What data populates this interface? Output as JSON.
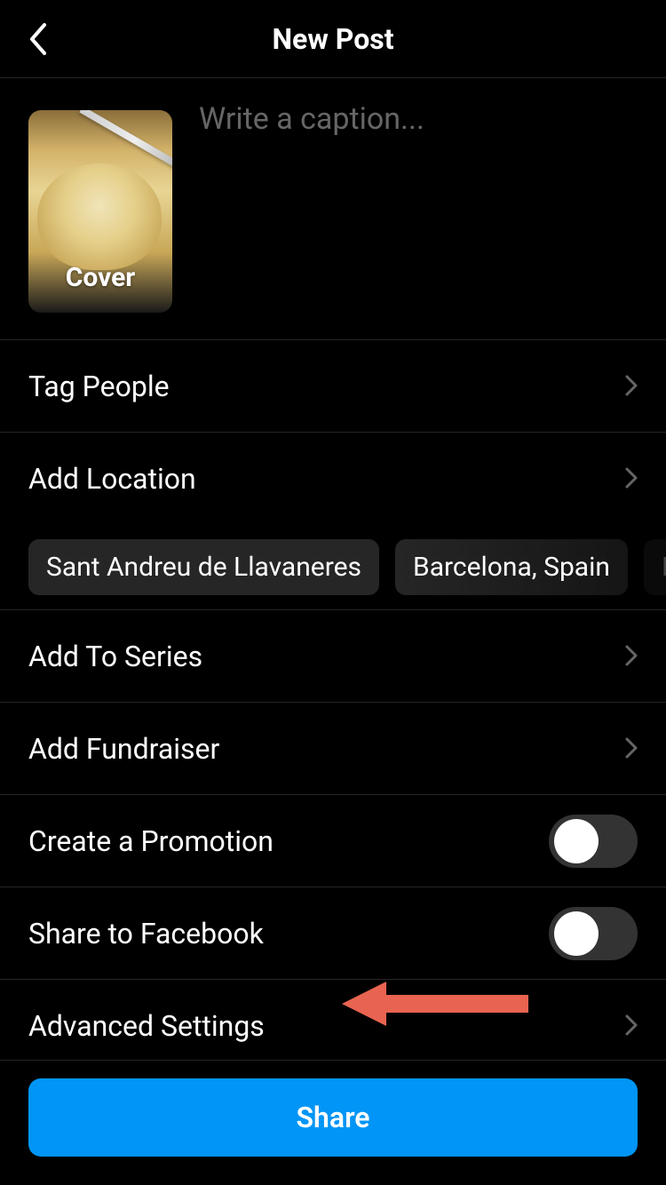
{
  "header": {
    "title": "New Post"
  },
  "caption": {
    "placeholder": "Write a caption...",
    "cover_label": "Cover"
  },
  "rows": {
    "tag_people": "Tag People",
    "add_location": "Add Location",
    "add_to_series": "Add To Series",
    "add_fundraiser": "Add Fundraiser",
    "create_promotion": "Create a Promotion",
    "share_facebook": "Share to Facebook",
    "advanced_settings": "Advanced Settings"
  },
  "location_chips": [
    "Sant Andreu de Llavaneres",
    "Barcelona, Spain",
    "LL"
  ],
  "toggles": {
    "create_promotion": false,
    "share_facebook": false
  },
  "footer": {
    "share_label": "Share"
  },
  "colors": {
    "accent": "#0095f6",
    "annotation_arrow": "#e86450"
  }
}
